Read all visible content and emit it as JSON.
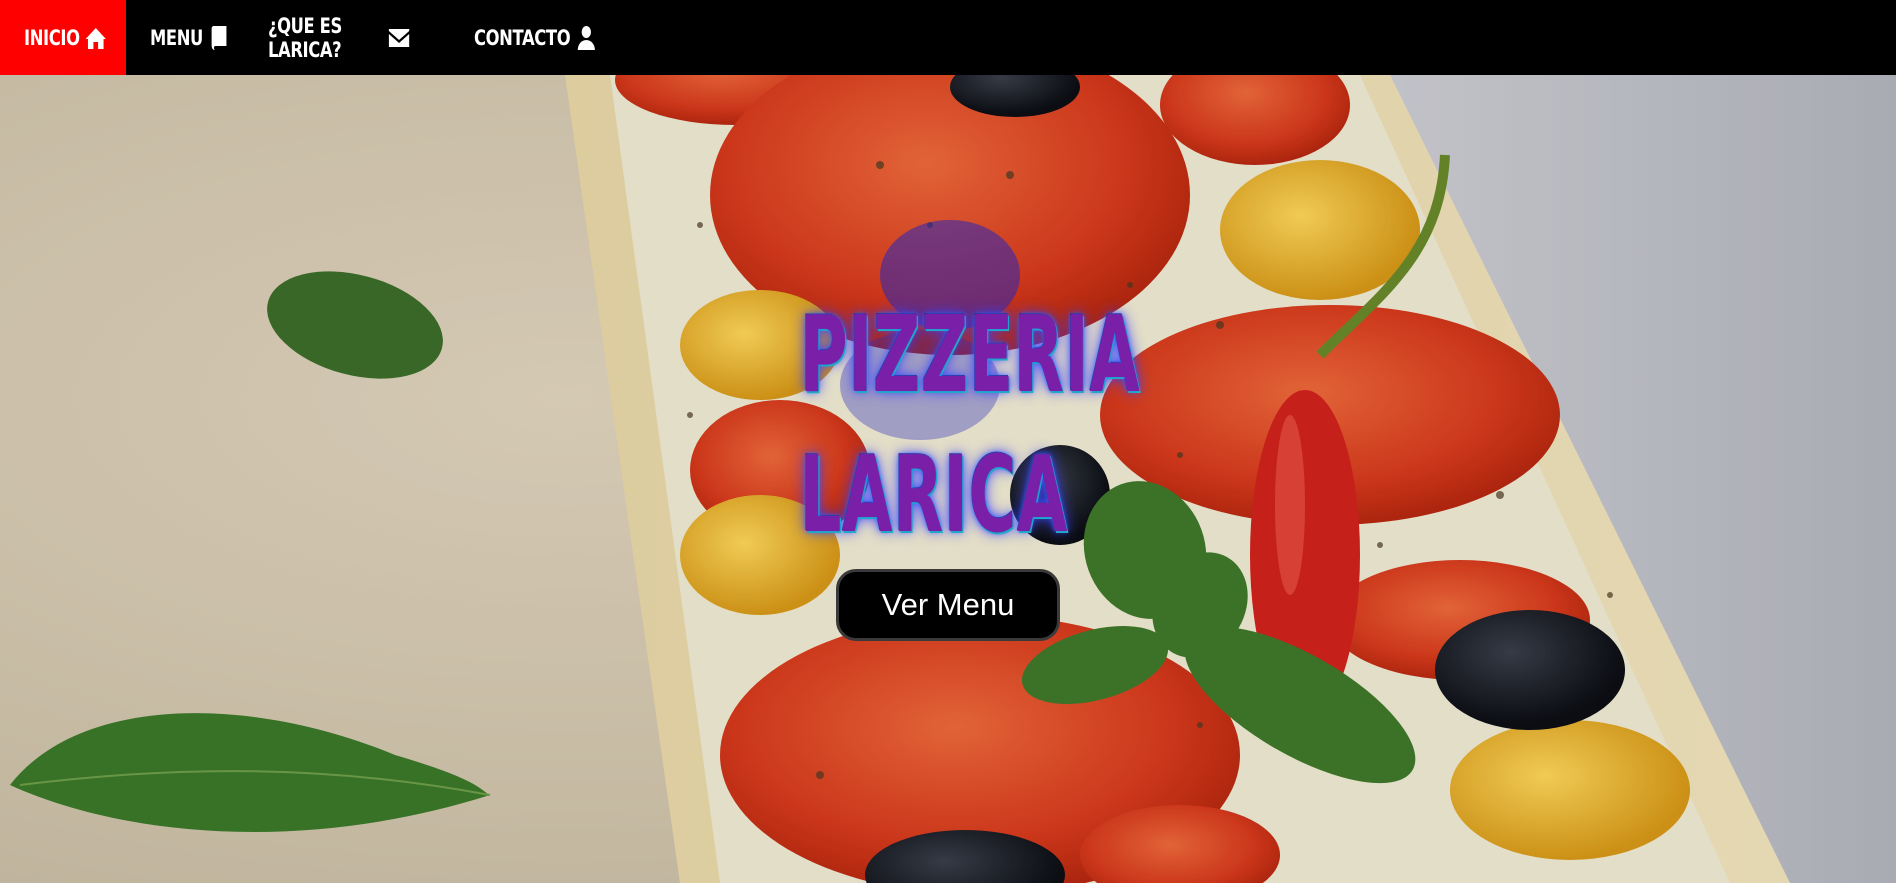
{
  "nav": {
    "items": [
      {
        "label": "INICIO",
        "icon": "home-icon",
        "active": true
      },
      {
        "label": "MENU",
        "icon": "book-icon",
        "active": false
      },
      {
        "label": "¿QUE ES LARICA?",
        "icon": "envelope-icon",
        "active": false
      },
      {
        "label": "CONTACTO",
        "icon": "user-icon",
        "active": false
      }
    ],
    "active_color": "#ff0000",
    "bar_color": "#000000"
  },
  "hero": {
    "title_line1": "PIZZERIA",
    "title_line2": "LARICA",
    "title_color": "#7a1fa8",
    "cta_label": "Ver Menu",
    "background_image": "pizza-photo"
  }
}
